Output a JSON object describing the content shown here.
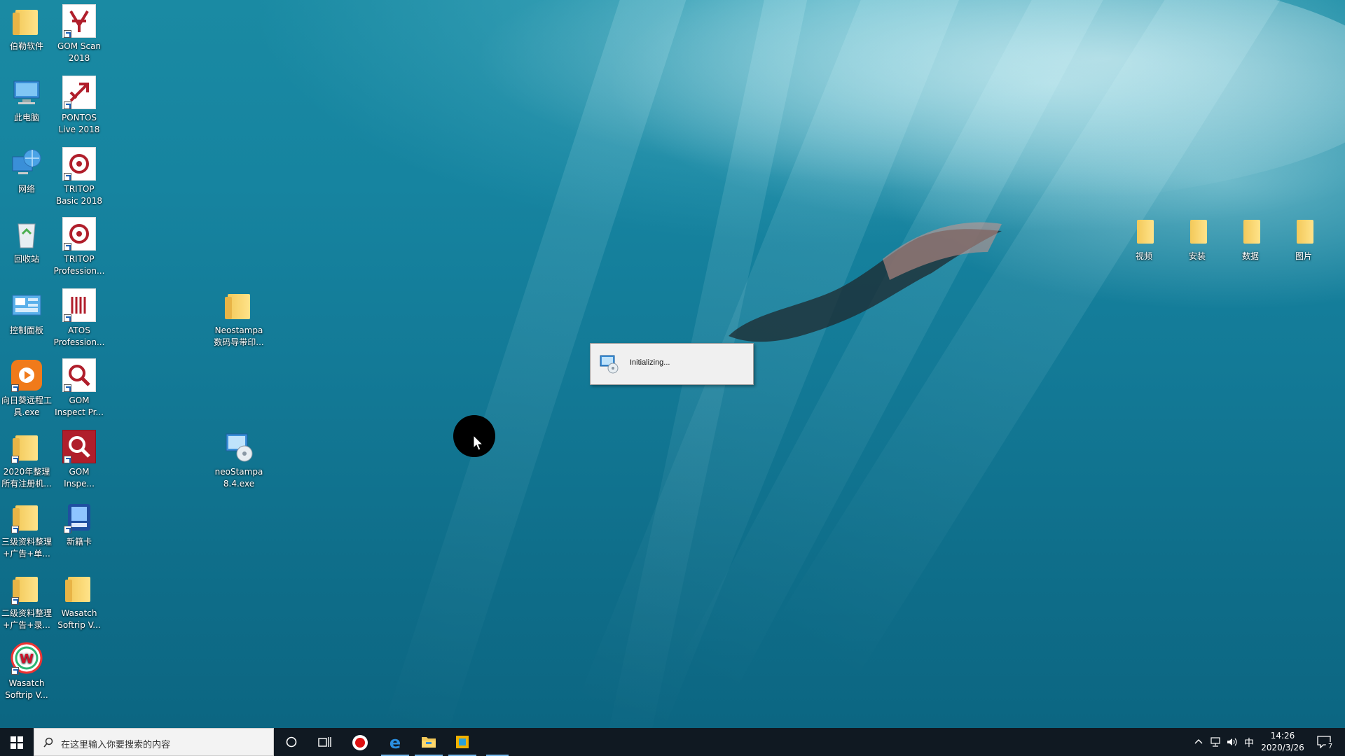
{
  "desktop": {
    "icons_left": [
      {
        "name": "folder-bole-icon",
        "label": "伯勒软件"
      },
      {
        "name": "gom-scan-icon",
        "label": "GOM Scan\n2018"
      },
      {
        "name": "this-pc-icon",
        "label": "此电脑"
      },
      {
        "name": "pontos-icon",
        "label": "PONTOS\nLive 2018"
      },
      {
        "name": "network-icon",
        "label": "网络"
      },
      {
        "name": "tritop-basic-icon",
        "label": "TRITOP\nBasic 2018"
      },
      {
        "name": "recycle-bin-icon",
        "label": "回收站"
      },
      {
        "name": "tritop-pro-icon",
        "label": "TRITOP\nProfession..."
      },
      {
        "name": "control-panel-icon",
        "label": "控制面板"
      },
      {
        "name": "atos-icon",
        "label": "ATOS\nProfession..."
      },
      {
        "name": "sunlogin-icon",
        "label": "向日葵远程工\n具.exe"
      },
      {
        "name": "gom-inspect-pr-icon",
        "label": "GOM\nInspect Pr..."
      },
      {
        "name": "folder-2020-icon",
        "label": "2020年整理\n所有注册机..."
      },
      {
        "name": "gom-inspe-icon",
        "label": "GOM\nInspe..."
      },
      {
        "name": "folder-level3-icon",
        "label": "三级资料整理\n+广告+单..."
      },
      {
        "name": "card-app-icon",
        "label": "新籍卡"
      },
      {
        "name": "folder-level2-icon",
        "label": "二级资料整理\n+广告+录..."
      },
      {
        "name": "wasatch-folder-icon",
        "label": "Wasatch\nSoftrip V..."
      },
      {
        "name": "wasatch-app-icon",
        "label": "Wasatch\nSoftrip V..."
      }
    ],
    "icons_mid": [
      {
        "name": "neostampa-folder-icon",
        "label": "Neostampa\n数码导带印..."
      },
      {
        "name": "neostampa-exe-icon",
        "label": "neoStampa\n8.4.exe"
      }
    ],
    "icons_right": [
      {
        "name": "folder-video-icon",
        "label": "视频"
      },
      {
        "name": "folder-install-icon",
        "label": "安装"
      },
      {
        "name": "folder-data-icon",
        "label": "数据"
      },
      {
        "name": "folder-pictures-icon",
        "label": "图片"
      }
    ]
  },
  "dialog": {
    "text": "Initializing..."
  },
  "taskbar": {
    "search_placeholder": "在这里输入你要搜索的内容",
    "ime": "中",
    "time": "14:26",
    "date": "2020/3/26",
    "notifications": "7"
  },
  "colors": {
    "taskbar": "#101922",
    "accent": "#76b9ed",
    "brand_red": "#b01e2b"
  }
}
